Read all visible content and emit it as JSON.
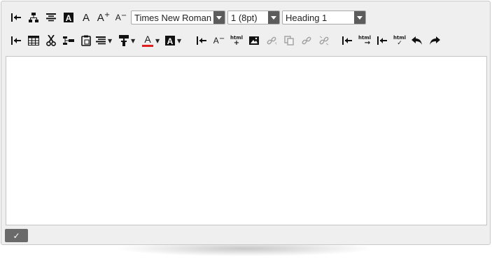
{
  "toolbar": {
    "font_family": {
      "value": "Times New Roman"
    },
    "font_size": {
      "value": "1 (8pt)"
    },
    "block_format": {
      "value": "Heading 1"
    },
    "bold_text_sample": "A",
    "large_text_sample": "A",
    "increase_label": "A",
    "decrease_label": "A",
    "font_color_label": "A",
    "highlight_label": "A",
    "html_label": "html"
  },
  "footer": {
    "submit_glyph": "✓"
  },
  "colors": {
    "toolbar_bg": "#efefef",
    "accent_red": "#e21d1d",
    "dropdown_button": "#5c5c5c"
  }
}
